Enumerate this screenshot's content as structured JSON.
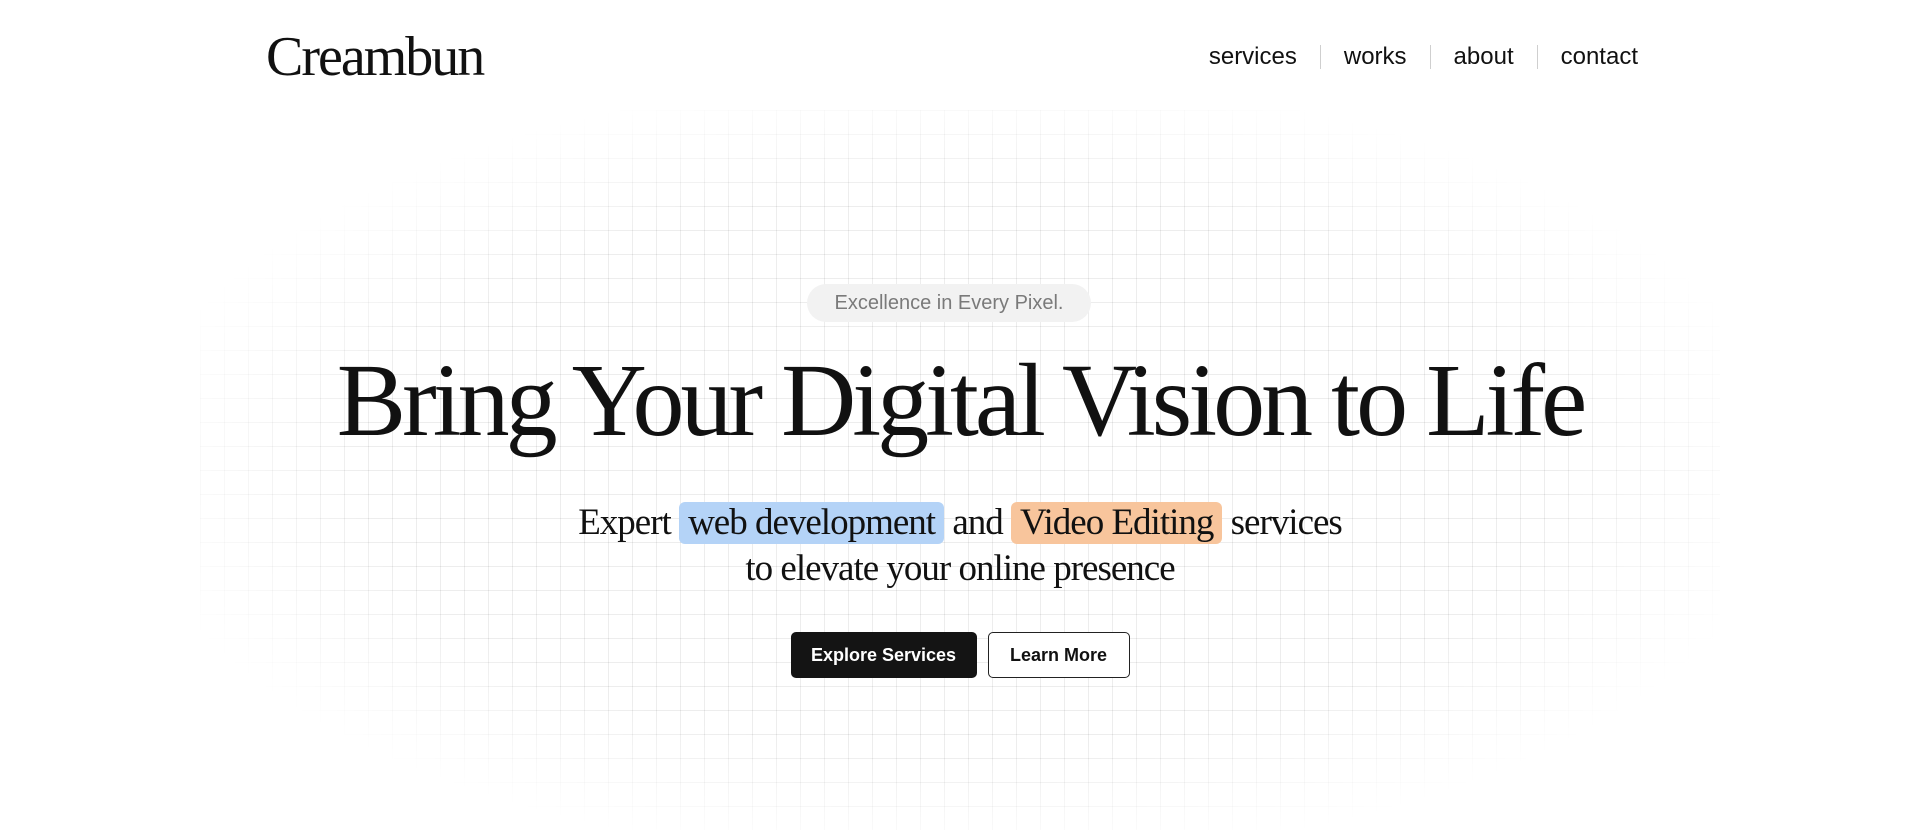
{
  "header": {
    "logo": "Creambun",
    "nav": [
      {
        "label": "services"
      },
      {
        "label": "works"
      },
      {
        "label": "about"
      },
      {
        "label": "contact"
      }
    ]
  },
  "hero": {
    "tagline": "Excellence in Every Pixel.",
    "headline": "Bring Your Digital Vision to Life",
    "subline": {
      "part1": "Expert",
      "highlight1": "web development",
      "part2": "and",
      "highlight2": "Video Editing",
      "part3": "services",
      "line2": "to elevate your online presence"
    },
    "buttons": {
      "primary": "Explore Services",
      "secondary": "Learn More"
    }
  },
  "colors": {
    "highlight_blue": "#b4d3f7",
    "highlight_orange": "#f8c59c",
    "primary_button": "#141414",
    "tagline_bg": "#f2f2f2"
  }
}
